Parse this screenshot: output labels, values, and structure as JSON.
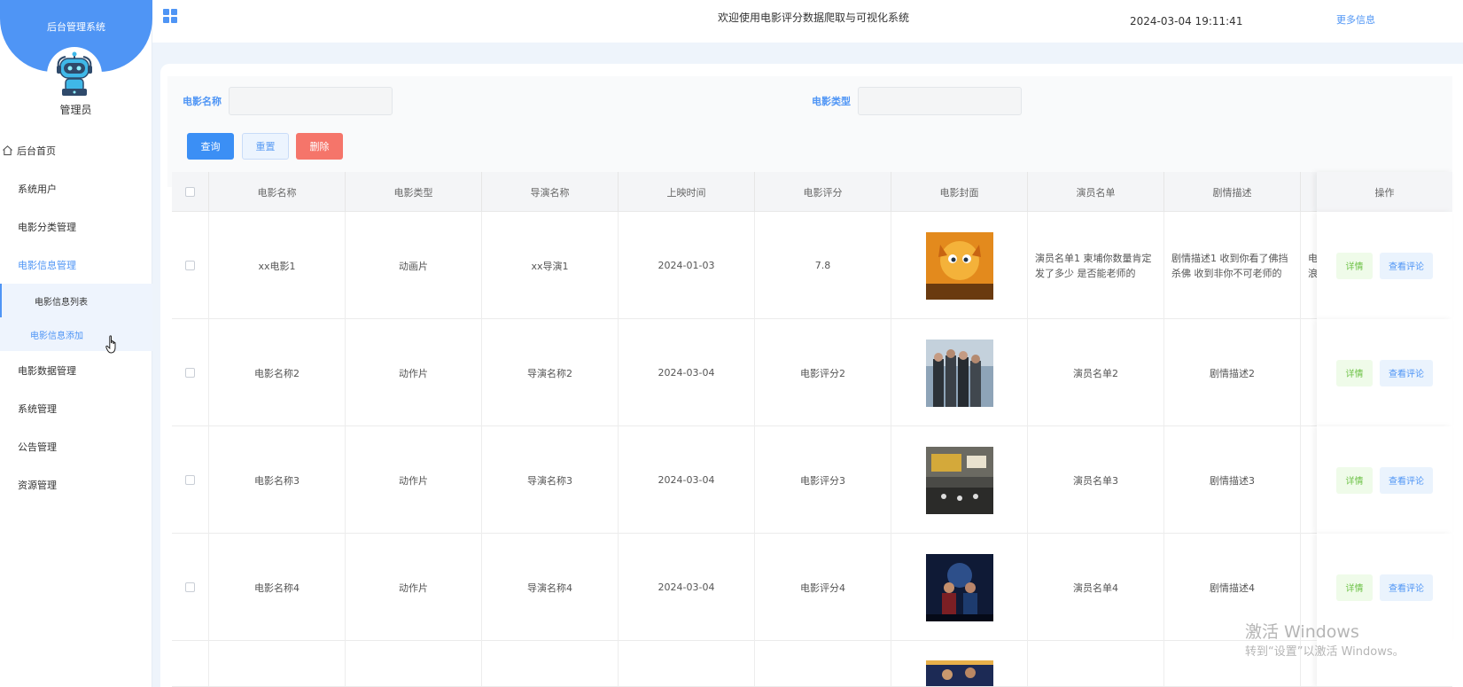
{
  "sidebar": {
    "title": "后台管理系统",
    "role": "管理员",
    "menu": [
      {
        "label": "后台首页"
      },
      {
        "label": "系统用户"
      },
      {
        "label": "电影分类管理"
      },
      {
        "label": "电影信息管理"
      },
      {
        "label": "电影信息列表"
      },
      {
        "label": "电影信息添加"
      },
      {
        "label": "电影数据管理"
      },
      {
        "label": "系统管理"
      },
      {
        "label": "公告管理"
      },
      {
        "label": "资源管理"
      }
    ]
  },
  "header": {
    "title": "欢迎使用电影评分数据爬取与可视化系统",
    "time": "2024-03-04 19:11:41",
    "more": "更多信息"
  },
  "search": {
    "name_label": "电影名称",
    "type_label": "电影类型",
    "query": "查询",
    "reset": "重置",
    "delete": "删除"
  },
  "table": {
    "headers": [
      "电影名称",
      "电影类型",
      "导演名称",
      "上映时间",
      "电影评分",
      "电影封面",
      "演员名单",
      "剧情描述",
      "操作"
    ],
    "rows": [
      {
        "name": "xx电影1",
        "type": "动画片",
        "director": "xx导演1",
        "date": "2024-01-03",
        "score": "7.8",
        "actors": "演员名单1 柬埔你数量肯定发了多少 是否能老师的",
        "plot": "剧情描述1 收到你看了佛挡杀佛 收到非你不可老师的",
        "extra": "电\n浪"
      },
      {
        "name": "电影名称2",
        "type": "动作片",
        "director": "导演名称2",
        "date": "2024-03-04",
        "score": "电影评分2",
        "actors": "演员名单2",
        "plot": "剧情描述2",
        "extra": ""
      },
      {
        "name": "电影名称3",
        "type": "动作片",
        "director": "导演名称3",
        "date": "2024-03-04",
        "score": "电影评分3",
        "actors": "演员名单3",
        "plot": "剧情描述3",
        "extra": ""
      },
      {
        "name": "电影名称4",
        "type": "动作片",
        "director": "导演名称4",
        "date": "2024-03-04",
        "score": "电影评分4",
        "actors": "演员名单4",
        "plot": "剧情描述4",
        "extra": ""
      }
    ],
    "detail": "详情",
    "comment": "查看评论"
  },
  "watermark": {
    "line1": "激活 Windows",
    "line2": "转到“设置”以激活 Windows。"
  }
}
